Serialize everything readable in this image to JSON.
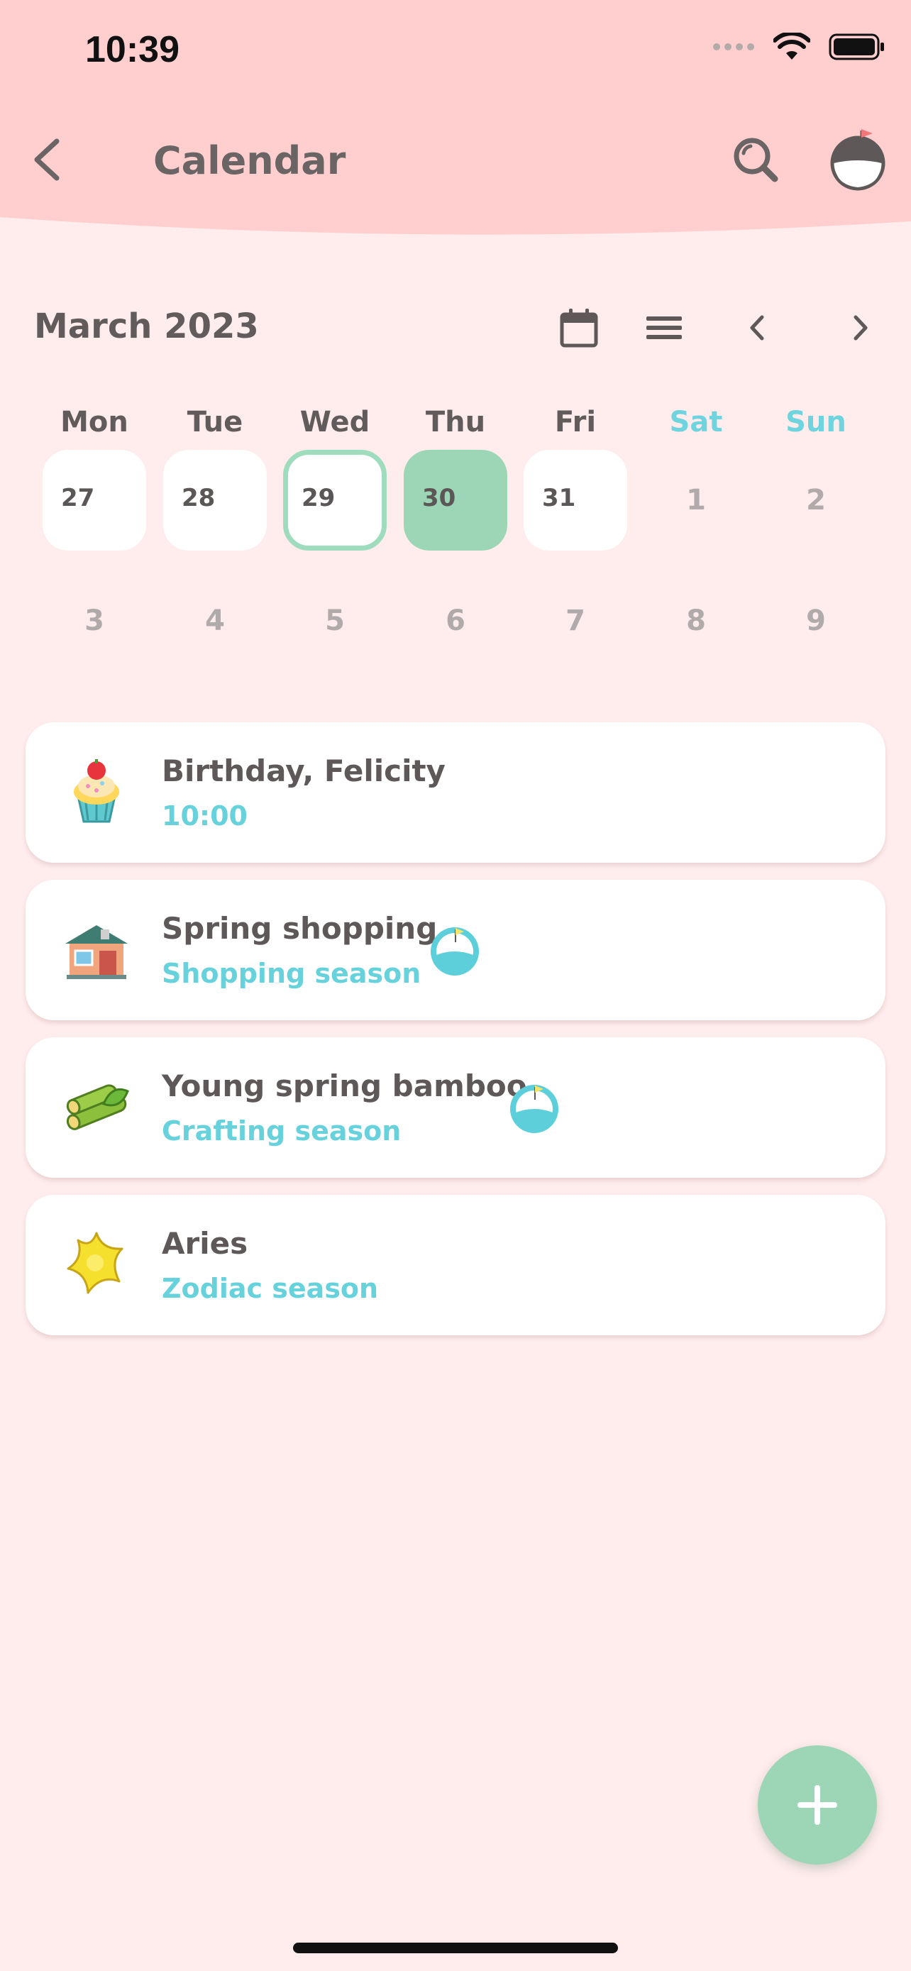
{
  "status_bar": {
    "time": "10:39"
  },
  "header": {
    "title": "Calendar"
  },
  "toolbar": {
    "month_label": "March 2023"
  },
  "weekdays": [
    {
      "label": "Mon",
      "weekend": false
    },
    {
      "label": "Tue",
      "weekend": false
    },
    {
      "label": "Wed",
      "weekend": false
    },
    {
      "label": "Thu",
      "weekend": false
    },
    {
      "label": "Fri",
      "weekend": false
    },
    {
      "label": "Sat",
      "weekend": true
    },
    {
      "label": "Sun",
      "weekend": true
    }
  ],
  "weeks": [
    [
      {
        "day": "27",
        "style": "card"
      },
      {
        "day": "28",
        "style": "card"
      },
      {
        "day": "29",
        "style": "selected"
      },
      {
        "day": "30",
        "style": "today"
      },
      {
        "day": "31",
        "style": "card"
      },
      {
        "day": "1",
        "style": "plain"
      },
      {
        "day": "2",
        "style": "plain"
      }
    ],
    [
      {
        "day": "3",
        "style": "plain"
      },
      {
        "day": "4",
        "style": "plain"
      },
      {
        "day": "5",
        "style": "plain"
      },
      {
        "day": "6",
        "style": "plain"
      },
      {
        "day": "7",
        "style": "plain"
      },
      {
        "day": "8",
        "style": "plain"
      },
      {
        "day": "9",
        "style": "plain"
      }
    ]
  ],
  "events": [
    {
      "title": "Birthday, Felicity",
      "subtitle": "10:00",
      "icon": "cupcake-icon",
      "has_badge": false
    },
    {
      "title": "Spring shopping",
      "subtitle": "Shopping season",
      "icon": "shop-icon",
      "has_badge": true
    },
    {
      "title": "Young spring bamboo",
      "subtitle": "Crafting season",
      "icon": "bamboo-icon",
      "has_badge": true
    },
    {
      "title": "Aries",
      "subtitle": "Zodiac season",
      "icon": "star-icon",
      "has_badge": false
    }
  ],
  "colors": {
    "header_bg": "#ffcfcf",
    "page_bg": "#ffecec",
    "accent_green": "#9dd6b7",
    "accent_cyan": "#67d2dc",
    "text": "#5b5757"
  }
}
